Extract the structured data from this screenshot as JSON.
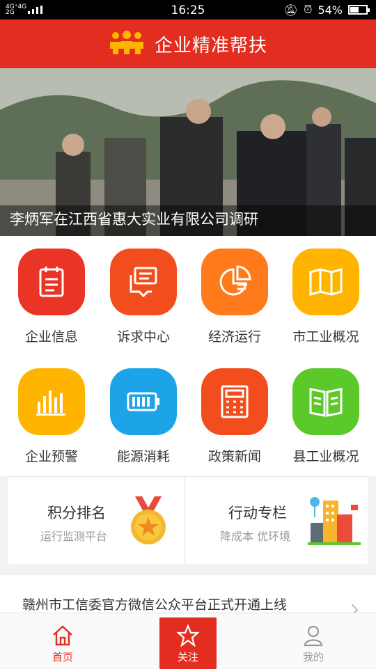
{
  "status_bar": {
    "network": "4G+ 4G\n2G",
    "time": "16:25",
    "battery": "54%",
    "battery_level": 0.54
  },
  "header": {
    "title": "企业精准帮扶"
  },
  "banner": {
    "caption": "李炳军在江西省惠大实业有限公司调研"
  },
  "grid": {
    "items": [
      {
        "label": "企业信息",
        "color": "#ea3426",
        "icon": "notepad-icon"
      },
      {
        "label": "诉求中心",
        "color": "#f24d1c",
        "icon": "message-icon"
      },
      {
        "label": "经济运行",
        "color": "#ff7a1a",
        "icon": "pie-chart-icon"
      },
      {
        "label": "市工业概况",
        "color": "#ffb400",
        "icon": "map-icon"
      },
      {
        "label": "企业预警",
        "color": "#ffb400",
        "icon": "bar-chart-icon"
      },
      {
        "label": "能源消耗",
        "color": "#1ca3e8",
        "icon": "battery-icon"
      },
      {
        "label": "政策新闻",
        "color": "#f24d1c",
        "icon": "calculator-icon"
      },
      {
        "label": "县工业概况",
        "color": "#5cc92a",
        "icon": "book-icon"
      }
    ]
  },
  "cards": {
    "ranking": {
      "title": "积分排名",
      "subtitle": "运行监测平台"
    },
    "action": {
      "title": "行动专栏",
      "subtitle": "降成本 优环境"
    }
  },
  "news": {
    "text": "赣州市工信委官方微信公众平台正式开通上线"
  },
  "tabbar": {
    "home": "首页",
    "follow": "关注",
    "mine": "我的",
    "active_color": "#e32d21",
    "inactive_color": "#999999"
  }
}
